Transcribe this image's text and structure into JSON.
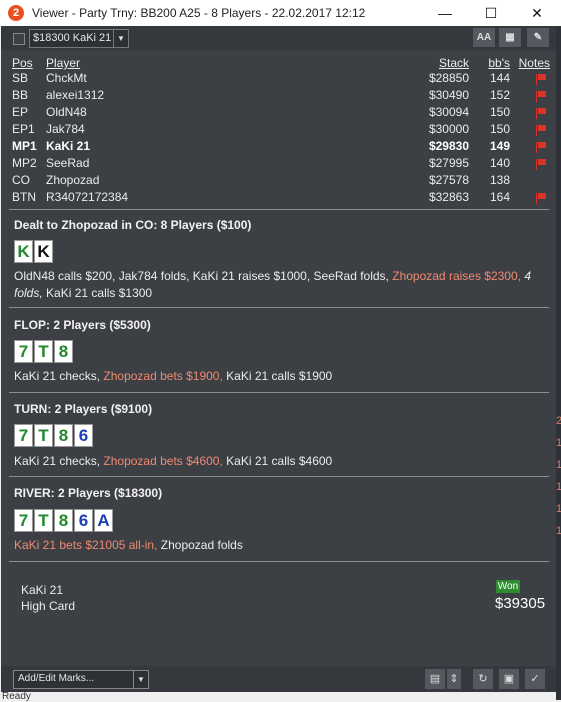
{
  "window": {
    "title": "Viewer - Party Trny: BB200 A25 - 8 Players - 22.02.2017 12:12",
    "app_icon": "2",
    "minimize": "—",
    "maximize": "☐",
    "close": "✕"
  },
  "toolbar": {
    "hand_select": "$18300 KaKi 21",
    "font_button": "AA",
    "grid_button": "▦",
    "edit_button": "✎"
  },
  "players_header": {
    "pos": "Pos",
    "player": "Player",
    "stack": "Stack",
    "bbs": "bb's",
    "notes": "Notes"
  },
  "players": [
    {
      "pos": "SB",
      "name": "ChckMt",
      "stack": "$28850",
      "bbs": "144",
      "flag": true,
      "bold": false
    },
    {
      "pos": "BB",
      "name": "alexei1312",
      "stack": "$30490",
      "bbs": "152",
      "flag": true,
      "bold": false
    },
    {
      "pos": "EP",
      "name": "OldN48",
      "stack": "$30094",
      "bbs": "150",
      "flag": true,
      "bold": false
    },
    {
      "pos": "EP1",
      "name": "Jak784",
      "stack": "$30000",
      "bbs": "150",
      "flag": true,
      "bold": false
    },
    {
      "pos": "MP1",
      "name": "KaKi 21",
      "stack": "$29830",
      "bbs": "149",
      "flag": true,
      "bold": true
    },
    {
      "pos": "MP2",
      "name": "SeeRad",
      "stack": "$27995",
      "bbs": "140",
      "flag": true,
      "bold": false
    },
    {
      "pos": "CO",
      "name": "Zhopozad",
      "stack": "$27578",
      "bbs": "138",
      "flag": false,
      "bold": false
    },
    {
      "pos": "BTN",
      "name": "R34072172384",
      "stack": "$32863",
      "bbs": "164",
      "flag": true,
      "bold": false
    }
  ],
  "streets": {
    "preflop": {
      "title": "Dealt to Zhopozad in CO: 8 Players ($100)",
      "cards": [
        "K",
        "K"
      ],
      "a1": "OldN48 calls $200, Jak784 folds, KaKi 21 raises $1000, SeeRad folds, ",
      "a2": "Zhopozad raises $2300,",
      "a3": "4 folds,",
      "a4": "KaKi 21 calls $1300"
    },
    "flop": {
      "title": "FLOP: 2 Players ($5300)",
      "cards": [
        "7",
        "T",
        "8"
      ],
      "a1": "KaKi 21 checks, ",
      "a2": "Zhopozad bets $1900,",
      "a3": " KaKi 21 calls $1900"
    },
    "turn": {
      "title": "TURN: 2 Players ($9100)",
      "cards": [
        "7",
        "T",
        "8",
        "6"
      ],
      "a1": "KaKi 21 checks, ",
      "a2": "Zhopozad bets $4600,",
      "a3": " KaKi 21 calls $4600"
    },
    "river": {
      "title": "RIVER: 2 Players ($18300)",
      "cards": [
        "7",
        "T",
        "8",
        "6",
        "A"
      ],
      "a1": "KaKi 21 bets $21005 all-in,",
      "a2": " Zhopozad folds"
    }
  },
  "result": {
    "player": "KaKi 21",
    "hand": "High Card",
    "won_label": "Won",
    "amount": "$39305"
  },
  "bottom": {
    "marks_select": "Add/Edit Marks...",
    "replay_icon": "↻",
    "save_icon": "▣",
    "twitter_icon": "✓"
  },
  "status": "Ready",
  "right_numbers": [
    "2",
    "1",
    "1",
    "1",
    "1",
    "1"
  ],
  "colors": {
    "highlight": "#f08a70",
    "panel": "#3c3f44",
    "won": "#2e8b2e"
  }
}
